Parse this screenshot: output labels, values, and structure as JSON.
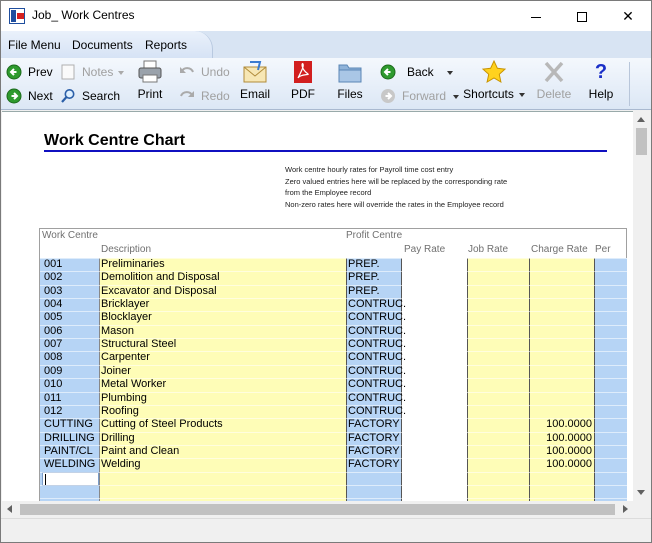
{
  "window": {
    "title": "Job_ Work Centres"
  },
  "menu": {
    "items": [
      "File Menu",
      "Documents",
      "Reports"
    ]
  },
  "toolbar": {
    "prev": "Prev",
    "next": "Next",
    "notes": "Notes",
    "search": "Search",
    "undo": "Undo",
    "redo": "Redo",
    "print": "Print",
    "email": "Email",
    "pdf": "PDF",
    "files": "Files",
    "back": "Back",
    "forward": "Forward",
    "shortcuts": "Shortcuts",
    "delete": "Delete",
    "help": "Help"
  },
  "report": {
    "title": "Work Centre Chart",
    "notes": [
      "Work centre hourly rates for Payroll time cost entry",
      "Zero valued entries here will be replaced by the corresponding rate",
      "from the Employee record",
      "Non-zero rates here will override the rates in the Employee record"
    ],
    "headers": {
      "work_centre": "Work Centre",
      "description": "Description",
      "profit_centre": "Profit Centre",
      "pay_rate": "Pay Rate",
      "job_rate": "Job Rate",
      "charge_rate": "Charge Rate",
      "per": "Per"
    },
    "rows": [
      {
        "wc": "001",
        "desc": "Preliminaries",
        "pc": "PREP.",
        "charge": ""
      },
      {
        "wc": "002",
        "desc": "Demolition and Disposal",
        "pc": "PREP.",
        "charge": ""
      },
      {
        "wc": "003",
        "desc": "Excavator and Disposal",
        "pc": "PREP.",
        "charge": ""
      },
      {
        "wc": "004",
        "desc": "Bricklayer",
        "pc": "CONTRUC.",
        "charge": ""
      },
      {
        "wc": "005",
        "desc": "Blocklayer",
        "pc": "CONTRUC.",
        "charge": ""
      },
      {
        "wc": "006",
        "desc": "Mason",
        "pc": "CONTRUC.",
        "charge": ""
      },
      {
        "wc": "007",
        "desc": "Structural Steel",
        "pc": "CONTRUC.",
        "charge": ""
      },
      {
        "wc": "008",
        "desc": "Carpenter",
        "pc": "CONTRUC.",
        "charge": ""
      },
      {
        "wc": "009",
        "desc": "Joiner",
        "pc": "CONTRUC.",
        "charge": ""
      },
      {
        "wc": "010",
        "desc": "Metal Worker",
        "pc": "CONTRUC.",
        "charge": ""
      },
      {
        "wc": "011",
        "desc": "Plumbing",
        "pc": "CONTRUC.",
        "charge": ""
      },
      {
        "wc": "012",
        "desc": "Roofing",
        "pc": "CONTRUC.",
        "charge": ""
      },
      {
        "wc": "CUTTING",
        "desc": "Cutting of Steel Products",
        "pc": "FACTORY",
        "charge": "100.0000"
      },
      {
        "wc": "DRILLING",
        "desc": "Drilling",
        "pc": "FACTORY",
        "charge": "100.0000"
      },
      {
        "wc": "PAINT/CL",
        "desc": "Paint and Clean",
        "pc": "FACTORY",
        "charge": "100.0000"
      },
      {
        "wc": "WELDING",
        "desc": "Welding",
        "pc": "FACTORY",
        "charge": "100.0000"
      }
    ]
  },
  "colors": {
    "blue_cell": "#b6d4f5",
    "yellow_cell": "#fefdb7",
    "title_rule": "#1010c0"
  }
}
